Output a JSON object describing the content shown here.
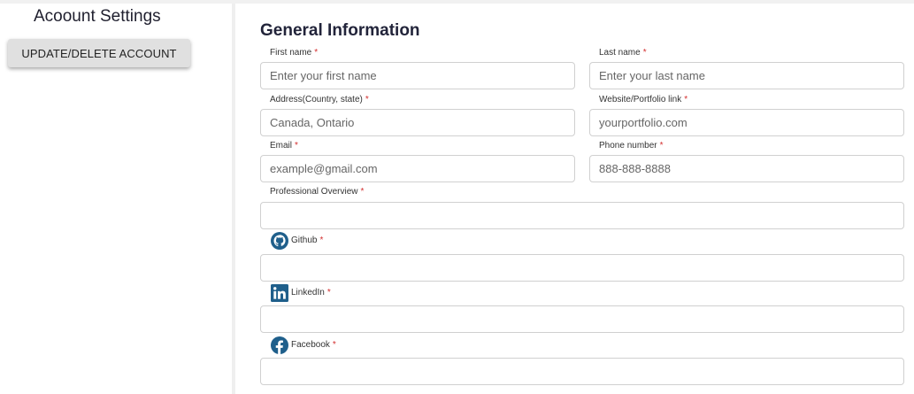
{
  "sidebar": {
    "title": "Acoount Settings",
    "button_label": "UPDATE/DELETE ACCOUNT"
  },
  "main": {
    "section_title": "General Information",
    "required_marker": "*",
    "fields": {
      "first_name": {
        "label": "First name",
        "placeholder": "Enter your first name",
        "value": ""
      },
      "last_name": {
        "label": "Last name",
        "placeholder": "Enter your last name",
        "value": ""
      },
      "address": {
        "label": "Address(Country, state)",
        "placeholder": "Canada, Ontario",
        "value": ""
      },
      "website": {
        "label": "Website/Portfolio link",
        "placeholder": "yourportfolio.com",
        "value": ""
      },
      "email": {
        "label": "Email",
        "placeholder": "example@gmail.com",
        "value": ""
      },
      "phone": {
        "label": "Phone number",
        "placeholder": "888-888-8888",
        "value": ""
      },
      "overview": {
        "label": "Professional Overview",
        "placeholder": "",
        "value": ""
      },
      "github": {
        "label": "Github",
        "icon": "github-icon",
        "placeholder": "",
        "value": ""
      },
      "linkedin": {
        "label": "LinkedIn",
        "icon": "linkedin-icon",
        "placeholder": "",
        "value": ""
      },
      "facebook": {
        "label": "Facebook",
        "icon": "facebook-icon",
        "placeholder": "",
        "value": ""
      }
    }
  },
  "colors": {
    "required": "#d32f2f",
    "button_bg": "#e0e0e0",
    "input_border": "#d0d0d0",
    "social_icon": "#1f5f8b"
  }
}
